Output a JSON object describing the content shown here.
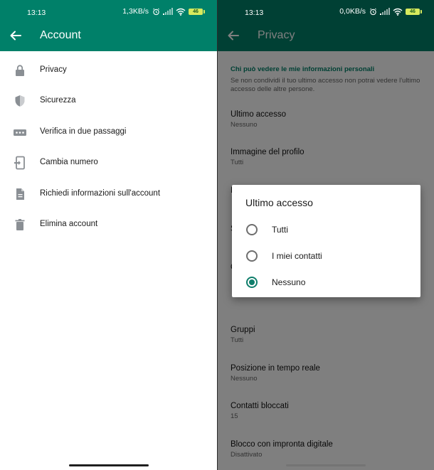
{
  "left": {
    "status": {
      "time": "13:13",
      "speed": "1,3KB/s",
      "battery": "46"
    },
    "appbar": {
      "title": "Account"
    },
    "menu": [
      {
        "label": "Privacy",
        "icon": "lock-icon"
      },
      {
        "label": "Sicurezza",
        "icon": "shield-icon"
      },
      {
        "label": "Verifica in due passaggi",
        "icon": "dots-icon"
      },
      {
        "label": "Cambia numero",
        "icon": "phone-change-icon"
      },
      {
        "label": "Richiedi informazioni sull'account",
        "icon": "document-icon"
      },
      {
        "label": "Elimina account",
        "icon": "trash-icon"
      }
    ]
  },
  "right": {
    "status": {
      "time": "13:13",
      "speed": "0,0KB/s",
      "battery": "46"
    },
    "appbar": {
      "title": "Privacy"
    },
    "section_title": "Chi può vedere le mie informazioni personali",
    "section_note": "Se non condividi il tuo ultimo accesso non potrai vedere l'ultimo accesso delle altre persone.",
    "items": [
      {
        "label": "Ultimo accesso",
        "sub": "Nessuno"
      },
      {
        "label": "Immagine del profilo",
        "sub": "Tutti"
      },
      {
        "label": "Gruppi",
        "sub": "Tutti"
      },
      {
        "label": "Posizione in tempo reale",
        "sub": "Nessuno"
      },
      {
        "label": "Contatti bloccati",
        "sub": "15"
      },
      {
        "label": "Blocco con impronta digitale",
        "sub": "Disattivato"
      }
    ],
    "dialog": {
      "title": "Ultimo accesso",
      "options": [
        "Tutti",
        "I miei contatti",
        "Nessuno"
      ],
      "selected": "Nessuno"
    }
  },
  "colors": {
    "header": "#008069",
    "accent": "#0f7e6b",
    "scrim": "rgba(0,0,0,0.5)"
  }
}
